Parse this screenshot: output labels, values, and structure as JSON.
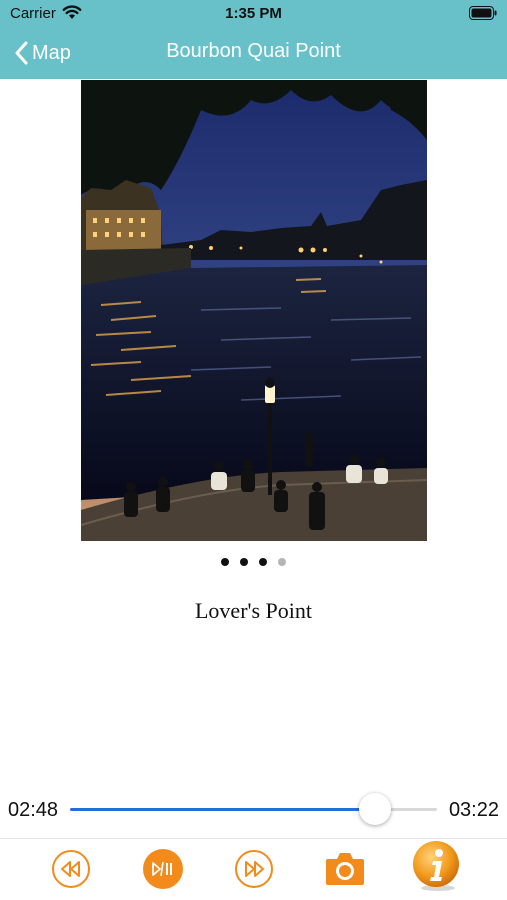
{
  "status_bar": {
    "carrier": "Carrier",
    "time": "1:35 PM"
  },
  "nav": {
    "back_label": "Map",
    "title": "Bourbon Quai Point"
  },
  "photo": {
    "pager_total": 4,
    "pager_active": 3
  },
  "caption": "Lover's Point",
  "player": {
    "elapsed": "02:48",
    "total": "03:22",
    "progress": 0.83
  },
  "colors": {
    "nav_background": "#68c0c8",
    "accent_orange": "#f28a1c",
    "progress_blue": "#1f6fe0"
  },
  "toolbar": {
    "icons": [
      "rewind-icon",
      "play-pause-icon",
      "fast-forward-icon",
      "camera-icon",
      "info-icon"
    ]
  }
}
